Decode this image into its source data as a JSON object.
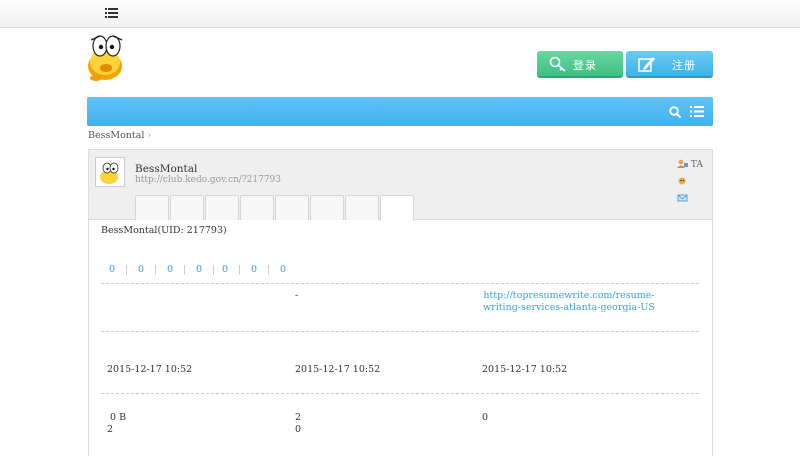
{
  "header": {
    "menu_icon": "menu-list-icon",
    "logo": "kedo-mascot-logo"
  },
  "auth": {
    "login_label": "登录",
    "register_label": "注册",
    "login_color": "#3fbf81",
    "register_color": "#40b2e6"
  },
  "navbar": {
    "color": "#43b0ee",
    "icons": [
      "search-icon",
      "list-icon"
    ]
  },
  "breadcrumb": {
    "user": "BessMontal",
    "separator": "›"
  },
  "profile": {
    "name": "BessMontal",
    "url": "http://club.kedo.gov.cn/?217793",
    "actions": {
      "follow": "TA"
    },
    "uid_line": "BessMontal(UID: 217793)",
    "stats": [
      "0",
      "0",
      "0",
      "0",
      "0",
      "0",
      "0"
    ],
    "stat_separator": "|",
    "info": {
      "dash": "-",
      "website": "http://topresumewrite.com/resume-writing-services-atlanta-georgia-US"
    },
    "times": [
      "2015-12-17 10:52",
      "2015-12-17 10:52",
      "2015-12-17 10:52"
    ],
    "usage": {
      "col1_line1": "0 B",
      "col1_line2": "2",
      "col2_line1": "2",
      "col2_line2": "0",
      "col3_line1": "0"
    }
  }
}
